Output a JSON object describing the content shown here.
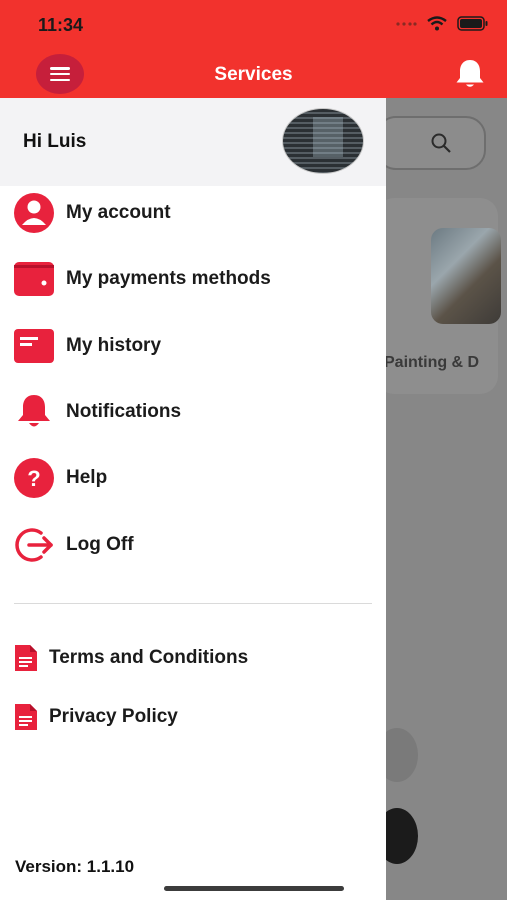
{
  "status_bar": {
    "time": "11:34"
  },
  "header": {
    "title": "Services",
    "menu_icon": "hamburger-icon",
    "bell_icon": "bell-icon"
  },
  "drawer": {
    "greeting": "Hi Luis",
    "menu_items": [
      {
        "label": "My account",
        "icon": "user-icon"
      },
      {
        "label": "My payments methods",
        "icon": "wallet-icon"
      },
      {
        "label": "My history",
        "icon": "history-icon"
      },
      {
        "label": "Notifications",
        "icon": "bell-icon"
      },
      {
        "label": "Help",
        "icon": "help-icon"
      },
      {
        "label": "Log Off",
        "icon": "logout-icon"
      }
    ],
    "links": [
      {
        "label": "Terms and Conditions",
        "icon": "document-icon"
      },
      {
        "label": "Privacy Policy",
        "icon": "document-icon"
      }
    ],
    "version": "Version: 1.1.10"
  },
  "background": {
    "card_label": "Painting & D"
  },
  "colors": {
    "brand": "#f2322d",
    "accent": "#e8223d",
    "menu_button": "#c61f3b"
  }
}
